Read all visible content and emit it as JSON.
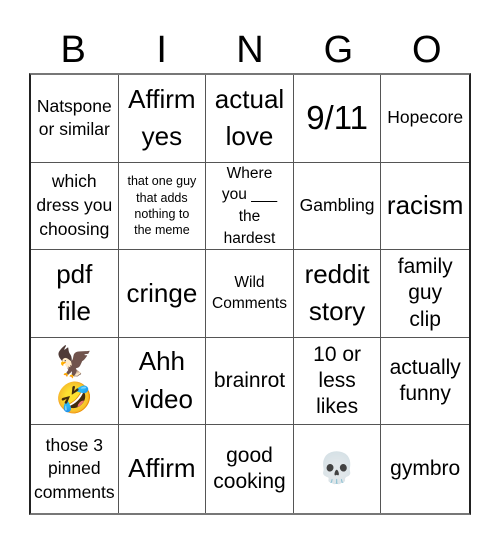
{
  "header": {
    "letters": [
      "B",
      "I",
      "N",
      "G",
      "O"
    ]
  },
  "cells": [
    {
      "text": "Natspone\nor similar",
      "size": "s-md"
    },
    {
      "text": "Affirm\nyes",
      "size": "s-xl"
    },
    {
      "text": "actual\nlove",
      "size": "s-xl"
    },
    {
      "text": "9/11",
      "size": "s-xxl"
    },
    {
      "text": "Hopecore",
      "size": "s-md"
    },
    {
      "text": "which\ndress you\nchoosing",
      "size": "s-md"
    },
    {
      "text": "that one guy\nthat adds\nnothing to\nthe meme",
      "size": "s-xs"
    },
    {
      "text": "Where\nyou ___\nthe\nhardest",
      "size": "s-sm"
    },
    {
      "text": "Gambling",
      "size": "s-md"
    },
    {
      "text": "racism",
      "size": "s-xl"
    },
    {
      "text": "pdf\nfile",
      "size": "s-xl"
    },
    {
      "text": "cringe",
      "size": "s-xl"
    },
    {
      "text": "Wild\nComments",
      "size": "s-sm"
    },
    {
      "text": "reddit\nstory",
      "size": "s-xl"
    },
    {
      "text": "family\nguy\nclip",
      "size": "s-lg"
    },
    {
      "text": "🦅\n🤣",
      "size": "emoji",
      "icon": "eagle-and-rofl-emoji-icon"
    },
    {
      "text": "Ahh\nvideo",
      "size": "s-xl"
    },
    {
      "text": "brainrot",
      "size": "s-lg"
    },
    {
      "text": "10 or\nless\nlikes",
      "size": "s-lg"
    },
    {
      "text": "actually\nfunny",
      "size": "s-lg"
    },
    {
      "text": "those 3\npinned\ncomments",
      "size": "s-md"
    },
    {
      "text": "Affirm",
      "size": "s-xl"
    },
    {
      "text": "good\ncooking",
      "size": "s-lg"
    },
    {
      "text": "💀",
      "size": "emoji",
      "icon": "skull-emoji-icon"
    },
    {
      "text": "gymbro",
      "size": "s-lg"
    }
  ]
}
